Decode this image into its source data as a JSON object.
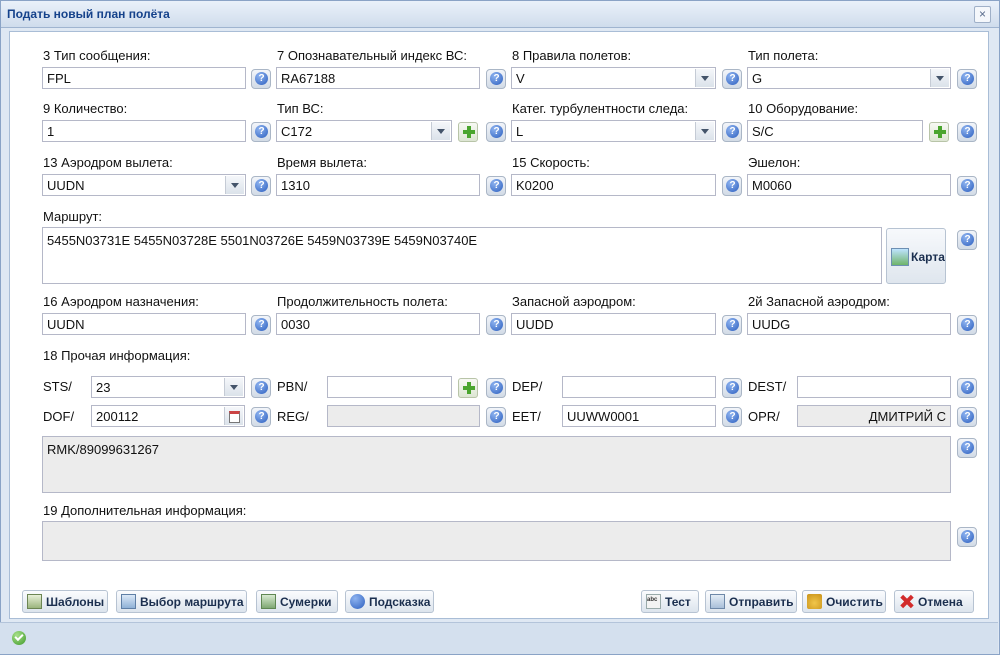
{
  "window": {
    "title": "Подать новый план полёта",
    "close_glyph": "×"
  },
  "row1": {
    "msg_type": {
      "label": "3 Тип сообщения:",
      "value": "FPL"
    },
    "callsign": {
      "label": "7 Опознавательный индекс ВС:",
      "value": "RA67188"
    },
    "flight_rules": {
      "label": "8 Правила полетов:",
      "value": "V"
    },
    "flight_type": {
      "label": "Тип полета:",
      "value": "G"
    }
  },
  "row2": {
    "count": {
      "label": "9 Количество:",
      "value": "1"
    },
    "aircraft_type": {
      "label": "Тип ВС:",
      "value": "C172"
    },
    "wake": {
      "label": "Катег. турбулентности следа:",
      "value": "L"
    },
    "equipment": {
      "label": "10 Оборудование:",
      "value": "S/C"
    }
  },
  "row3": {
    "dep_aerodrome": {
      "label": "13 Аэродром вылета:",
      "value": "UUDN"
    },
    "dep_time": {
      "label": "Время вылета:",
      "value": "1310"
    },
    "speed": {
      "label": "15 Скорость:",
      "value": "K0200"
    },
    "level": {
      "label": "Эшелон:",
      "value": "M0060"
    }
  },
  "route": {
    "label": "Маршрут:",
    "value": "5455N03731E 5455N03728E 5501N03726E 5459N03739E 5459N03740E",
    "map_button": "Карта"
  },
  "row4": {
    "dest": {
      "label": "16 Аэродром назначения:",
      "value": "UUDN"
    },
    "duration": {
      "label": "Продолжительность полета:",
      "value": "0030"
    },
    "alt1": {
      "label": "Запасной аэродром:",
      "value": "UUDD"
    },
    "alt2": {
      "label": "2й Запасной аэродром:",
      "value": "UUDG"
    }
  },
  "other": {
    "label": "18 Прочая информация:",
    "sts": {
      "label": "STS/",
      "value": "23"
    },
    "pbn": {
      "label": "PBN/",
      "value": ""
    },
    "dep": {
      "label": "DEP/",
      "value": ""
    },
    "dest": {
      "label": "DEST/",
      "value": ""
    },
    "dof": {
      "label": "DOF/",
      "value": "200112"
    },
    "reg": {
      "label": "REG/",
      "value": ""
    },
    "eet": {
      "label": "EET/",
      "value": "UUWW0001"
    },
    "opr": {
      "label": "OPR/",
      "value": "ДМИТРИЙ С"
    },
    "rmk": "RMK/89099631267"
  },
  "additional": {
    "label": "19 Дополнительная информация:",
    "value": ""
  },
  "buttons": {
    "templates": "Шаблоны",
    "route_select": "Выбор маршрута",
    "twilight": "Сумерки",
    "hint": "Подсказка",
    "test": "Тест",
    "send": "Отправить",
    "clear": "Очистить",
    "cancel": "Отмена"
  }
}
